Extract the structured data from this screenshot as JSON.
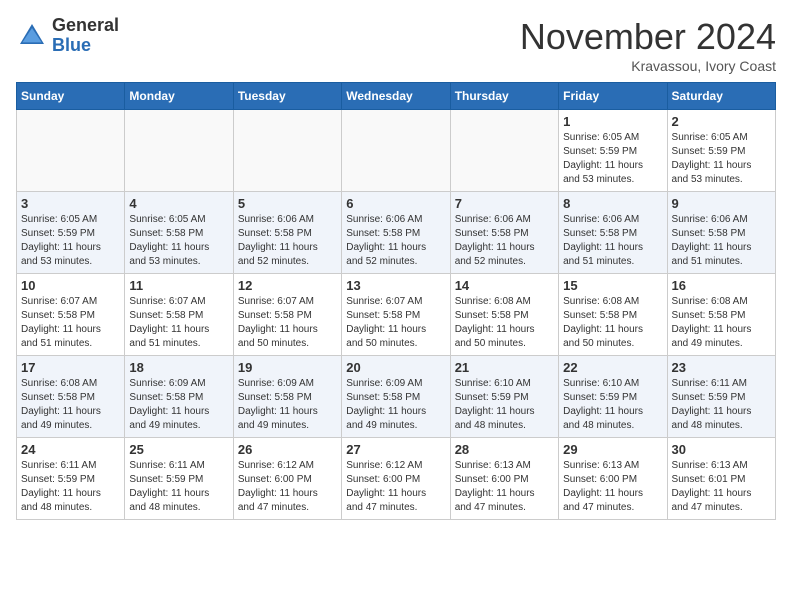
{
  "header": {
    "logo_general": "General",
    "logo_blue": "Blue",
    "month_title": "November 2024",
    "location": "Kravassou, Ivory Coast"
  },
  "calendar": {
    "days_of_week": [
      "Sunday",
      "Monday",
      "Tuesday",
      "Wednesday",
      "Thursday",
      "Friday",
      "Saturday"
    ],
    "weeks": [
      [
        {
          "day": "",
          "info": ""
        },
        {
          "day": "",
          "info": ""
        },
        {
          "day": "",
          "info": ""
        },
        {
          "day": "",
          "info": ""
        },
        {
          "day": "",
          "info": ""
        },
        {
          "day": "1",
          "info": "Sunrise: 6:05 AM\nSunset: 5:59 PM\nDaylight: 11 hours\nand 53 minutes."
        },
        {
          "day": "2",
          "info": "Sunrise: 6:05 AM\nSunset: 5:59 PM\nDaylight: 11 hours\nand 53 minutes."
        }
      ],
      [
        {
          "day": "3",
          "info": "Sunrise: 6:05 AM\nSunset: 5:59 PM\nDaylight: 11 hours\nand 53 minutes."
        },
        {
          "day": "4",
          "info": "Sunrise: 6:05 AM\nSunset: 5:58 PM\nDaylight: 11 hours\nand 53 minutes."
        },
        {
          "day": "5",
          "info": "Sunrise: 6:06 AM\nSunset: 5:58 PM\nDaylight: 11 hours\nand 52 minutes."
        },
        {
          "day": "6",
          "info": "Sunrise: 6:06 AM\nSunset: 5:58 PM\nDaylight: 11 hours\nand 52 minutes."
        },
        {
          "day": "7",
          "info": "Sunrise: 6:06 AM\nSunset: 5:58 PM\nDaylight: 11 hours\nand 52 minutes."
        },
        {
          "day": "8",
          "info": "Sunrise: 6:06 AM\nSunset: 5:58 PM\nDaylight: 11 hours\nand 51 minutes."
        },
        {
          "day": "9",
          "info": "Sunrise: 6:06 AM\nSunset: 5:58 PM\nDaylight: 11 hours\nand 51 minutes."
        }
      ],
      [
        {
          "day": "10",
          "info": "Sunrise: 6:07 AM\nSunset: 5:58 PM\nDaylight: 11 hours\nand 51 minutes."
        },
        {
          "day": "11",
          "info": "Sunrise: 6:07 AM\nSunset: 5:58 PM\nDaylight: 11 hours\nand 51 minutes."
        },
        {
          "day": "12",
          "info": "Sunrise: 6:07 AM\nSunset: 5:58 PM\nDaylight: 11 hours\nand 50 minutes."
        },
        {
          "day": "13",
          "info": "Sunrise: 6:07 AM\nSunset: 5:58 PM\nDaylight: 11 hours\nand 50 minutes."
        },
        {
          "day": "14",
          "info": "Sunrise: 6:08 AM\nSunset: 5:58 PM\nDaylight: 11 hours\nand 50 minutes."
        },
        {
          "day": "15",
          "info": "Sunrise: 6:08 AM\nSunset: 5:58 PM\nDaylight: 11 hours\nand 50 minutes."
        },
        {
          "day": "16",
          "info": "Sunrise: 6:08 AM\nSunset: 5:58 PM\nDaylight: 11 hours\nand 49 minutes."
        }
      ],
      [
        {
          "day": "17",
          "info": "Sunrise: 6:08 AM\nSunset: 5:58 PM\nDaylight: 11 hours\nand 49 minutes."
        },
        {
          "day": "18",
          "info": "Sunrise: 6:09 AM\nSunset: 5:58 PM\nDaylight: 11 hours\nand 49 minutes."
        },
        {
          "day": "19",
          "info": "Sunrise: 6:09 AM\nSunset: 5:58 PM\nDaylight: 11 hours\nand 49 minutes."
        },
        {
          "day": "20",
          "info": "Sunrise: 6:09 AM\nSunset: 5:58 PM\nDaylight: 11 hours\nand 49 minutes."
        },
        {
          "day": "21",
          "info": "Sunrise: 6:10 AM\nSunset: 5:59 PM\nDaylight: 11 hours\nand 48 minutes."
        },
        {
          "day": "22",
          "info": "Sunrise: 6:10 AM\nSunset: 5:59 PM\nDaylight: 11 hours\nand 48 minutes."
        },
        {
          "day": "23",
          "info": "Sunrise: 6:11 AM\nSunset: 5:59 PM\nDaylight: 11 hours\nand 48 minutes."
        }
      ],
      [
        {
          "day": "24",
          "info": "Sunrise: 6:11 AM\nSunset: 5:59 PM\nDaylight: 11 hours\nand 48 minutes."
        },
        {
          "day": "25",
          "info": "Sunrise: 6:11 AM\nSunset: 5:59 PM\nDaylight: 11 hours\nand 48 minutes."
        },
        {
          "day": "26",
          "info": "Sunrise: 6:12 AM\nSunset: 6:00 PM\nDaylight: 11 hours\nand 47 minutes."
        },
        {
          "day": "27",
          "info": "Sunrise: 6:12 AM\nSunset: 6:00 PM\nDaylight: 11 hours\nand 47 minutes."
        },
        {
          "day": "28",
          "info": "Sunrise: 6:13 AM\nSunset: 6:00 PM\nDaylight: 11 hours\nand 47 minutes."
        },
        {
          "day": "29",
          "info": "Sunrise: 6:13 AM\nSunset: 6:00 PM\nDaylight: 11 hours\nand 47 minutes."
        },
        {
          "day": "30",
          "info": "Sunrise: 6:13 AM\nSunset: 6:01 PM\nDaylight: 11 hours\nand 47 minutes."
        }
      ]
    ]
  }
}
